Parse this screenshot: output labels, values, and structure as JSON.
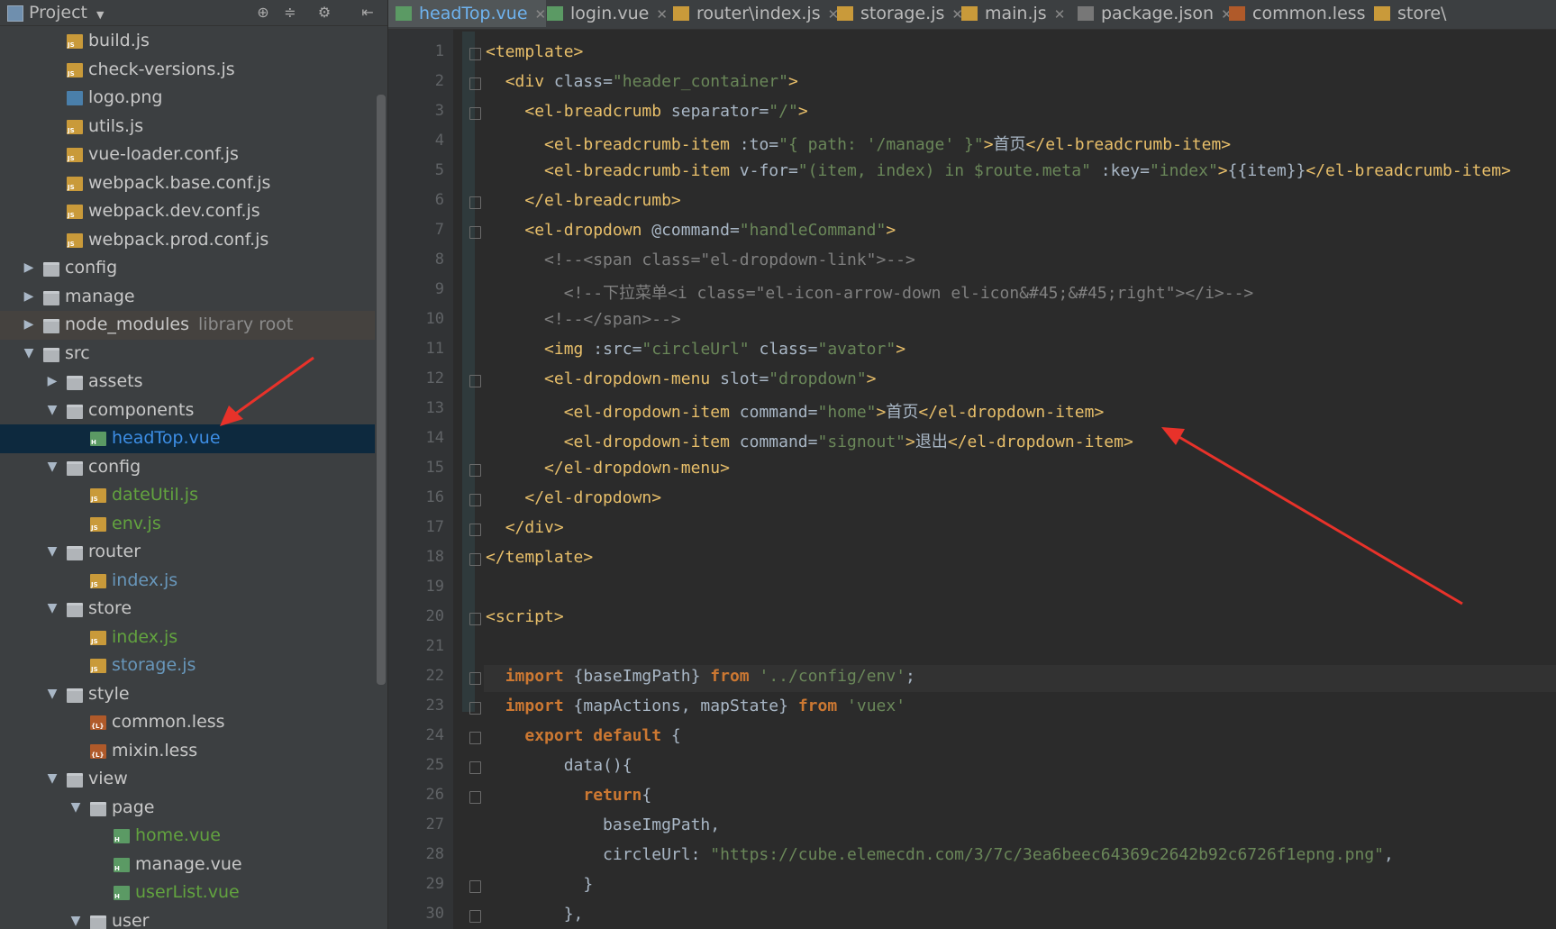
{
  "project_panel": {
    "title": "Project",
    "tree": [
      {
        "label": "build.js",
        "type": "js",
        "depth": 2,
        "color": "def"
      },
      {
        "label": "check-versions.js",
        "type": "js",
        "depth": 2,
        "color": "def"
      },
      {
        "label": "logo.png",
        "type": "png",
        "depth": 2,
        "color": "def"
      },
      {
        "label": "utils.js",
        "type": "js",
        "depth": 2,
        "color": "def"
      },
      {
        "label": "vue-loader.conf.js",
        "type": "js",
        "depth": 2,
        "color": "def"
      },
      {
        "label": "webpack.base.conf.js",
        "type": "js",
        "depth": 2,
        "color": "def"
      },
      {
        "label": "webpack.dev.conf.js",
        "type": "js",
        "depth": 2,
        "color": "def"
      },
      {
        "label": "webpack.prod.conf.js",
        "type": "js",
        "depth": 2,
        "color": "def"
      },
      {
        "label": "config",
        "type": "folder",
        "depth": 1,
        "arrow": "right",
        "color": "def"
      },
      {
        "label": "manage",
        "type": "folder",
        "depth": 1,
        "arrow": "right",
        "color": "def"
      },
      {
        "label": "node_modules",
        "suffix": "library root",
        "type": "folder",
        "depth": 1,
        "arrow": "right",
        "color": "def",
        "lib": true
      },
      {
        "label": "src",
        "type": "folder",
        "depth": 1,
        "arrow": "down",
        "color": "def"
      },
      {
        "label": "assets",
        "type": "folder",
        "depth": 2,
        "arrow": "right",
        "color": "def"
      },
      {
        "label": "components",
        "type": "folder",
        "depth": 2,
        "arrow": "down",
        "color": "def"
      },
      {
        "label": "headTop.vue",
        "type": "vue",
        "depth": 3,
        "color": "sel",
        "selected": true
      },
      {
        "label": "config",
        "type": "folder",
        "depth": 2,
        "arrow": "down",
        "color": "def"
      },
      {
        "label": "dateUtil.js",
        "type": "js",
        "depth": 3,
        "color": "green"
      },
      {
        "label": "env.js",
        "type": "js",
        "depth": 3,
        "color": "green"
      },
      {
        "label": "router",
        "type": "folder",
        "depth": 2,
        "arrow": "down",
        "color": "def"
      },
      {
        "label": "index.js",
        "type": "js",
        "depth": 3,
        "color": "blue"
      },
      {
        "label": "store",
        "type": "folder",
        "depth": 2,
        "arrow": "down",
        "color": "def"
      },
      {
        "label": "index.js",
        "type": "js",
        "depth": 3,
        "color": "green"
      },
      {
        "label": "storage.js",
        "type": "js",
        "depth": 3,
        "color": "blue"
      },
      {
        "label": "style",
        "type": "folder",
        "depth": 2,
        "arrow": "down",
        "color": "def"
      },
      {
        "label": "common.less",
        "type": "less",
        "depth": 3,
        "color": "def"
      },
      {
        "label": "mixin.less",
        "type": "less",
        "depth": 3,
        "color": "def"
      },
      {
        "label": "view",
        "type": "folder",
        "depth": 2,
        "arrow": "down",
        "color": "def"
      },
      {
        "label": "page",
        "type": "folder",
        "depth": 3,
        "arrow": "down",
        "color": "def"
      },
      {
        "label": "home.vue",
        "type": "vue",
        "depth": 4,
        "color": "green"
      },
      {
        "label": "manage.vue",
        "type": "vue",
        "depth": 4,
        "color": "def"
      },
      {
        "label": "userList.vue",
        "type": "vue",
        "depth": 4,
        "color": "green"
      },
      {
        "label": "user",
        "type": "folder",
        "depth": 3,
        "arrow": "down",
        "color": "def"
      }
    ]
  },
  "tabs": [
    {
      "label": "headTop.vue",
      "type": "vue",
      "active": true
    },
    {
      "label": "login.vue",
      "type": "vue"
    },
    {
      "label": "router\\index.js",
      "type": "js"
    },
    {
      "label": "storage.js",
      "type": "js"
    },
    {
      "label": "main.js",
      "type": "js"
    },
    {
      "label": "package.json",
      "type": "json"
    },
    {
      "label": "common.less",
      "type": "less"
    },
    {
      "label": "store\\",
      "type": "js"
    }
  ],
  "colors": {
    "background": "#2b2b2b",
    "panel": "#3c3f41",
    "selection": "#0d293e",
    "annotation_arrow": "#e8322a"
  },
  "editor": {
    "lines": [
      "<template>",
      "  <div class=\"header_container\">",
      "    <el-breadcrumb separator=\"/\">",
      "      <el-breadcrumb-item :to=\"{ path: '/manage' }\">首页</el-breadcrumb-item>",
      "      <el-breadcrumb-item v-for=\"(item, index) in $route.meta\" :key=\"index\">{{item}}</el-breadcrumb-item>",
      "    </el-breadcrumb>",
      "    <el-dropdown @command=\"handleCommand\">",
      "      <!--<span class=\"el-dropdown-link\">-->",
      "        <!--下拉菜单<i class=\"el-icon-arrow-down el-icon&#45;&#45;right\"></i>-->",
      "      <!--</span>-->",
      "      <img :src=\"circleUrl\" class=\"avator\">",
      "      <el-dropdown-menu slot=\"dropdown\">",
      "        <el-dropdown-item command=\"home\">首页</el-dropdown-item>",
      "        <el-dropdown-item command=\"signout\">退出</el-dropdown-item>",
      "      </el-dropdown-menu>",
      "    </el-dropdown>",
      "  </div>",
      "</template>",
      "",
      "<script>",
      "",
      "  import {baseImgPath} from '../config/env';",
      "  import {mapActions, mapState} from 'vuex'",
      "    export default {",
      "        data(){",
      "          return{",
      "            baseImgPath,",
      "            circleUrl: \"https://cube.elemecdn.com/3/7c/3ea6beec64369c2642b92c6726f1epng.png\",",
      "          }",
      "        },"
    ],
    "line_numbers": [
      "1",
      "2",
      "3",
      "4",
      "5",
      "6",
      "7",
      "8",
      "9",
      "10",
      "11",
      "12",
      "13",
      "14",
      "15",
      "16",
      "17",
      "18",
      "19",
      "20",
      "21",
      "22",
      "23",
      "24",
      "25",
      "26",
      "27",
      "28",
      "29",
      "30"
    ]
  }
}
